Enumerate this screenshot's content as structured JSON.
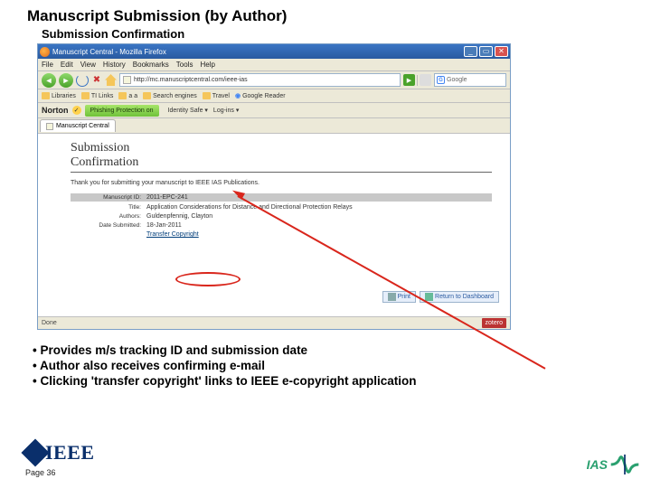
{
  "slide": {
    "title": "Manuscript Submission (by Author)",
    "subtitle": "Submission Confirmation",
    "page_label": "Page 36"
  },
  "browser": {
    "window_title": "Manuscript Central - Mozilla Firefox",
    "menu": {
      "file": "File",
      "edit": "Edit",
      "view": "View",
      "history": "History",
      "bookmarks": "Bookmarks",
      "tools": "Tools",
      "help": "Help"
    },
    "url": "http://mc.manuscriptcentral.com/ieee-ias",
    "search_placeholder": "Google",
    "bookmarks": [
      "Libraries",
      "TI Links",
      "a a",
      "Search engines",
      "Travel",
      "Google Reader"
    ],
    "norton": {
      "brand": "Norton",
      "phishing": "Phishing Protection on",
      "identity": "Identity Safe ▾",
      "logins": "Log-ins ▾"
    },
    "tab_label": "Manuscript Central",
    "status_left": "Done",
    "status_right": "zotero"
  },
  "page": {
    "heading": "Submission\nConfirmation",
    "thank_you": "Thank you for submitting your manuscript to IEEE IAS Publications.",
    "rows": {
      "ms_id_label": "Manuscript ID:",
      "ms_id_value": "2011-EPC-241",
      "title_label": "Title:",
      "title_value": "Application Considerations for Distance and Directional Protection Relays",
      "authors_label": "Authors:",
      "authors_value": "Guldenpfennig, Clayton",
      "date_label": "Date Submitted:",
      "date_value": "18-Jan-2011"
    },
    "transfer_link": "Transfer Copyright",
    "print_btn": "Print",
    "return_btn": "Return to Dashboard"
  },
  "bullets": [
    "Provides m/s tracking ID and submission date",
    "Author also receives confirming e-mail",
    "Clicking 'transfer copyright' links to IEEE e-copyright application"
  ],
  "logos": {
    "ieee": "IEEE",
    "ias": "IAS"
  }
}
